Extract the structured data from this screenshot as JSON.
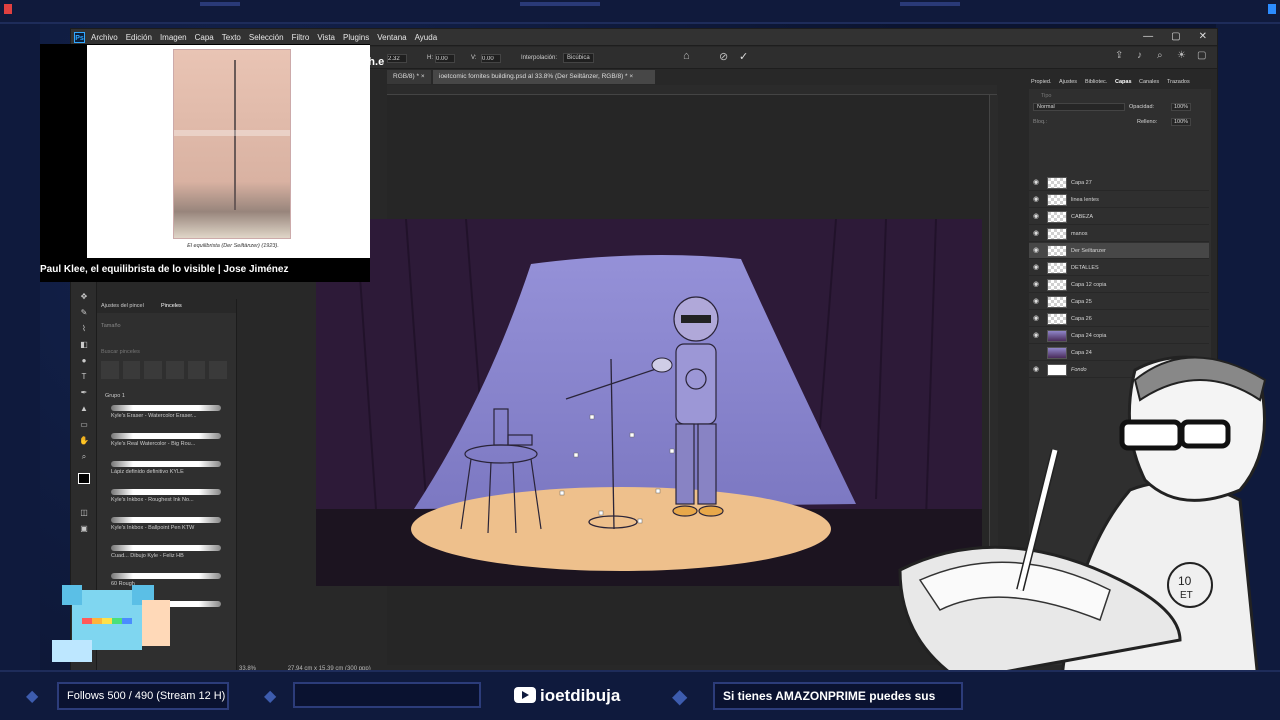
{
  "window": {
    "menus": [
      "Archivo",
      "Edición",
      "Imagen",
      "Capa",
      "Texto",
      "Selección",
      "Filtro",
      "Vista",
      "Plugins",
      "Ventana",
      "Ayuda"
    ],
    "controls": [
      "—",
      "▢",
      "✕"
    ]
  },
  "options": {
    "field1": "2.32",
    "h_label": "H:",
    "h_value": "0.00",
    "v_label": "V:",
    "v_value": "0.00",
    "interp_label": "Interpolación:",
    "interp_value": "Bicúbica"
  },
  "tabs": {
    "tab1": "RGB/8) *",
    "tab2": "ioetcomic fornites building.psd al 33.8% (Der Seiltänzer, RGB/8) *"
  },
  "status": {
    "zoom": "33.8%",
    "doc_size": "27.94 cm x 15.39 cm (300 ppp)"
  },
  "brush_panel": {
    "tab1": "Ajustes del pincel",
    "tab2": "Pinceles",
    "size_label": "Tamaño",
    "search_placeholder": "Buscar pinceles",
    "group": "Grupo 1",
    "brushes": [
      "Kyle's Eraser - Watercolor Eraser...",
      "Kyle's Real Watercolor - Big Rou...",
      "Lápiz definido definitivo KYLE",
      "Kyle's Inkbox - Roughest Ink No...",
      "Kyle's Inkbox - Ballpoint Pen KTW",
      "Cuad... Dibujo Kyle - Feliz HB",
      "60 Rough",
      "Wet Blender"
    ]
  },
  "layers_panel": {
    "tabs": [
      "Propied.",
      "Ajustes",
      "Bibliotec.",
      "Capas",
      "Canales",
      "Trazados"
    ],
    "active_tab": "Capas",
    "search_placeholder": "Tipo",
    "blend_mode": "Normal",
    "opacity_label": "Opacidad:",
    "opacity_value": "100%",
    "fill_label": "Relleno:",
    "fill_value": "100%",
    "lock_label": "Bloq.:",
    "layers": [
      {
        "name": "Capa 27",
        "thumb": "checker"
      },
      {
        "name": "linea lentes",
        "thumb": "checker"
      },
      {
        "name": "CABEZA",
        "thumb": "checker"
      },
      {
        "name": "manos",
        "thumb": "checker"
      },
      {
        "name": "Der Seiltanzer",
        "thumb": "checker",
        "selected": true
      },
      {
        "name": "DETALLES",
        "thumb": "checker"
      },
      {
        "name": "Capa 12 copia",
        "thumb": "checker"
      },
      {
        "name": "Capa 25",
        "thumb": "checker"
      },
      {
        "name": "Capa 26",
        "thumb": "checker"
      },
      {
        "name": "Capa 24 copia",
        "thumb": "purple"
      },
      {
        "name": "Capa 24",
        "thumb": "purple",
        "hidden": true
      },
      {
        "name": "Fondo",
        "thumb": "white",
        "italic": true
      }
    ]
  },
  "video": {
    "caption": "El equilibrista (Der Seiltänzer) (1923).",
    "logo": "march.e",
    "title": "Paul Klee, el equilibrista de lo visible | Jose Jiménez"
  },
  "bottom_bar": {
    "follows": "Follows 500 / 490 (Stream 12 H)",
    "handle": "ioetdibuja",
    "ticker": "Si tienes AMAZONPRIME puedes sus"
  },
  "colors": {
    "ps_bg": "#282828",
    "stream_frame": "#0f1a3d",
    "curtain": "#3a2148",
    "stage_backdrop": "#8a86cc",
    "spotlight": "#efc08a"
  }
}
